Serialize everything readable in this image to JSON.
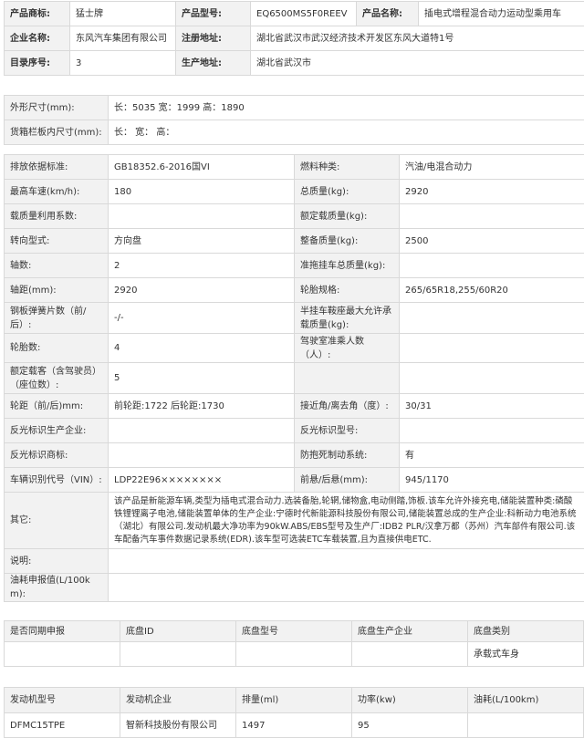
{
  "top": {
    "rows": [
      [
        {
          "label": "产品商标:",
          "value": "猛士牌"
        },
        {
          "label": "产品型号:",
          "value": "EQ6500MS5F0REEV"
        },
        {
          "label": "产品名称:",
          "value": "插电式增程混合动力运动型乘用车"
        }
      ],
      [
        {
          "label": "企业名称:",
          "value": "东风汽车集团有限公司"
        },
        {
          "label": "注册地址:",
          "value": "湖北省武汉市武汉经济技术开发区东风大道特1号"
        }
      ],
      [
        {
          "label": "目录序号:",
          "value": "3"
        },
        {
          "label": "生产地址:",
          "value": "湖北省武汉市"
        }
      ]
    ]
  },
  "main": {
    "full_rows": [
      {
        "label": "外形尺寸(mm):",
        "value": "长：5035 宽：1999 高：1890"
      },
      {
        "label": "货箱栏板内尺寸(mm):",
        "value": "长： 宽： 高："
      }
    ],
    "pair_rows": [
      [
        {
          "label": "排放依据标准:",
          "value": "GB18352.6-2016国VI"
        },
        {
          "label": "燃料种类:",
          "value": "汽油/电混合动力"
        }
      ],
      [
        {
          "label": "最高车速(km/h):",
          "value": "180"
        },
        {
          "label": "总质量(kg):",
          "value": "2920"
        }
      ],
      [
        {
          "label": "载质量利用系数:",
          "value": ""
        },
        {
          "label": "额定载质量(kg):",
          "value": ""
        }
      ],
      [
        {
          "label": "转向型式:",
          "value": "方向盘"
        },
        {
          "label": "整备质量(kg):",
          "value": "2500"
        }
      ],
      [
        {
          "label": "轴数:",
          "value": "2"
        },
        {
          "label": "准拖挂车总质量(kg):",
          "value": ""
        }
      ],
      [
        {
          "label": "轴距(mm):",
          "value": "2920"
        },
        {
          "label": "轮胎规格:",
          "value": "265/65R18,255/60R20"
        }
      ],
      [
        {
          "label": "钢板弹簧片数（前/后）:",
          "value": "-/-"
        },
        {
          "label": "半挂车鞍座最大允许承载质量(kg):",
          "value": ""
        }
      ],
      [
        {
          "label": "轮胎数:",
          "value": "4"
        },
        {
          "label": "驾驶室准乘人数（人）:",
          "value": ""
        }
      ],
      [
        {
          "label": "额定载客（含驾驶员）（座位数）:",
          "value": "5"
        },
        {
          "label": "",
          "value": ""
        }
      ],
      [
        {
          "label": "轮距（前/后)mm:",
          "value": "前轮距:1722 后轮距:1730"
        },
        {
          "label": "接近角/离去角（度）:",
          "value": "30/31"
        }
      ],
      [
        {
          "label": "反光标识生产企业:",
          "value": ""
        },
        {
          "label": "反光标识型号:",
          "value": ""
        }
      ],
      [
        {
          "label": "反光标识商标:",
          "value": ""
        },
        {
          "label": "防抱死制动系统:",
          "value": "有"
        }
      ],
      [
        {
          "label": "车辆识别代号（VIN）:",
          "value": "LDP22E96××××××××"
        },
        {
          "label": "前悬/后悬(mm):",
          "value": "945/1170"
        }
      ]
    ],
    "other": {
      "label": "其它:",
      "value": "该产品是新能源车辆,类型为插电式混合动力.选装备胎,轮辋,储物盒,电动侧踏,饰板.该车允许外接充电,储能装置种类:磷酸铁锂锂离子电池,储能装置单体的生产企业:宁德时代新能源科技股份有限公司,储能装置总成的生产企业:科新动力电池系统（湖北）有限公司.发动机最大净功率为90kW.ABS/EBS型号及生产厂:IDB2 PLR/汉拿万都（苏州）汽车部件有限公司.该车配备汽车事件数据记录系统(EDR).该车型可选装ETC车载装置,且为直接供电ETC."
    },
    "note": {
      "label": "说明:",
      "value": ""
    },
    "fuel": {
      "label": "油耗申报值(L/100km):",
      "value": ""
    }
  },
  "chassis": {
    "headers": [
      "是否同期申报",
      "底盘ID",
      "底盘型号",
      "底盘生产企业",
      "底盘类别"
    ],
    "row": [
      "",
      "",
      "",
      "",
      "承载式车身"
    ]
  },
  "engine": {
    "headers": [
      "发动机型号",
      "发动机企业",
      "排量(ml)",
      "功率(kw)",
      "油耗(L/100km)"
    ],
    "row": [
      "DFMC15TPE",
      "智新科技股份有限公司",
      "1497",
      "95",
      ""
    ]
  }
}
